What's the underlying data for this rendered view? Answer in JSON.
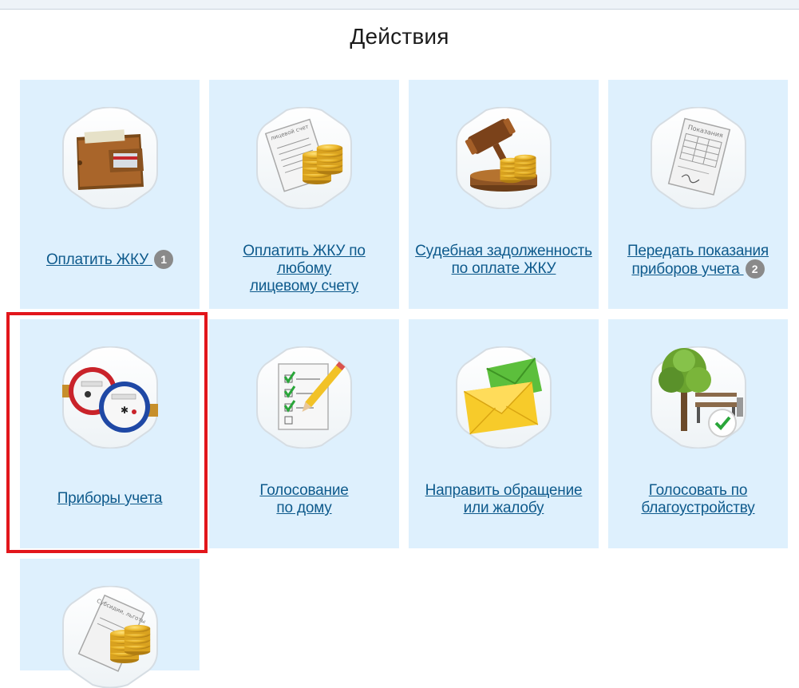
{
  "page": {
    "title": "Действия"
  },
  "actions": [
    {
      "label": "Оплатить ЖКУ",
      "badge": "1",
      "icon": "wallet-icon"
    },
    {
      "label_line1": "Оплатить ЖКУ по любому",
      "label_line2": "лицевому счету",
      "icon": "account-coins-icon",
      "doc_text": "лицевой счет"
    },
    {
      "label_line1": "Судебная задолженность",
      "label_line2": "по оплате ЖКУ",
      "icon": "gavel-coins-icon"
    },
    {
      "label_line1": "Передать показания",
      "label_line2": "приборов учета",
      "badge": "2",
      "icon": "readings-document-icon",
      "doc_text": "Показания"
    },
    {
      "label": "Приборы учета",
      "icon": "water-meter-icon",
      "highlighted": true
    },
    {
      "label_line1": "Голосование",
      "label_line2": "по дому",
      "icon": "checklist-pencil-icon"
    },
    {
      "label_line1": "Направить обращение",
      "label_line2": "или жалобу",
      "icon": "envelopes-icon"
    },
    {
      "label_line1": "Голосовать по",
      "label_line2": "благоустройству",
      "icon": "tree-bench-check-icon"
    },
    {
      "icon": "subsidies-coins-icon",
      "doc_text": "Субсидии, льготы"
    }
  ],
  "colors": {
    "tile_bg": "#def0fd",
    "link": "#0e5a8c",
    "badge": "#8a8a8a",
    "highlight": "#e2161b"
  }
}
